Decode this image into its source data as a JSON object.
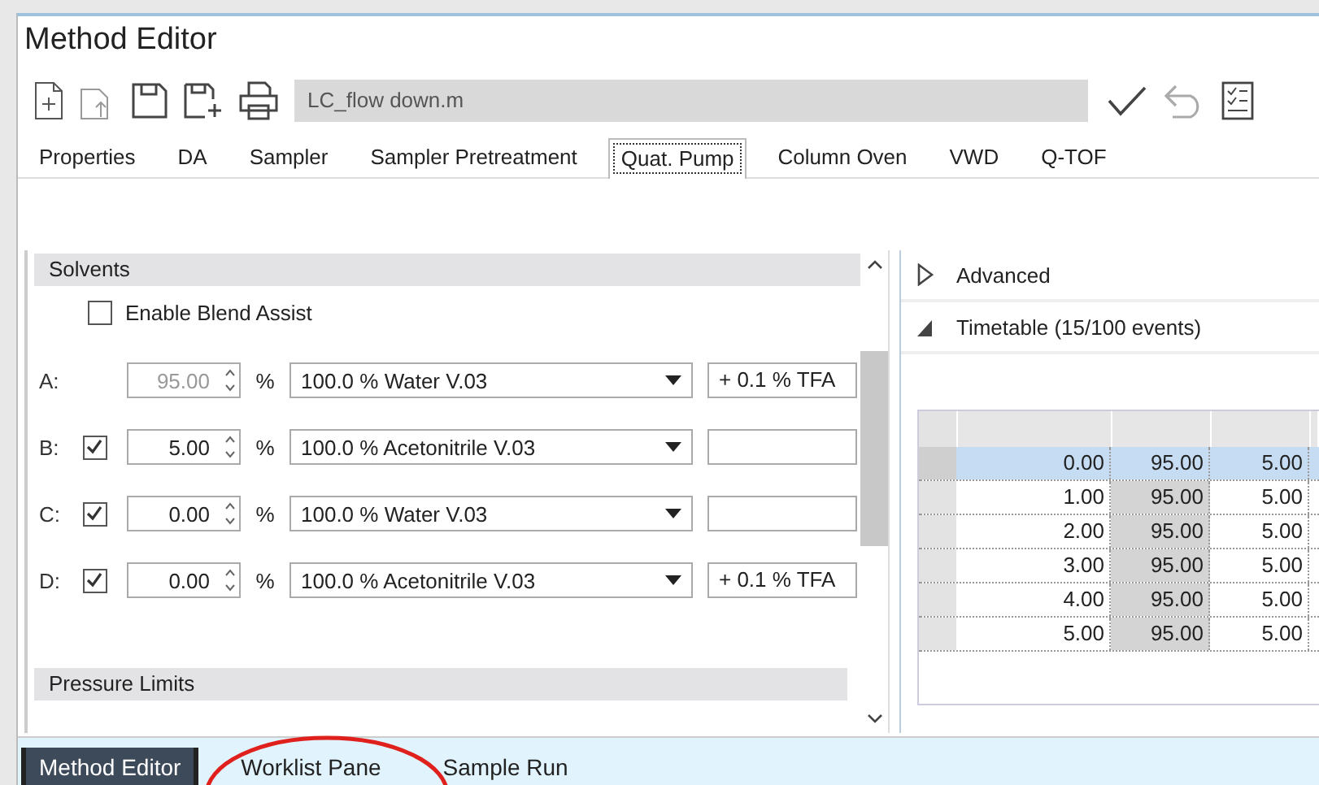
{
  "window": {
    "title": "Method Editor"
  },
  "toolbar": {
    "method_file": "LC_flow down.m"
  },
  "tabs": [
    {
      "label": "Properties",
      "selected": false
    },
    {
      "label": "DA",
      "selected": false
    },
    {
      "label": "Sampler",
      "selected": false
    },
    {
      "label": "Sampler Pretreatment",
      "selected": false
    },
    {
      "label": "Quat. Pump",
      "selected": true
    },
    {
      "label": "Column Oven",
      "selected": false
    },
    {
      "label": "VWD",
      "selected": false
    },
    {
      "label": "Q-TOF",
      "selected": false
    }
  ],
  "solvents": {
    "title": "Solvents",
    "blend_assist": {
      "label": "Enable Blend Assist",
      "checked": false
    },
    "unit": "%",
    "channels": [
      {
        "label": "A:",
        "value": "95.00",
        "disabled": true,
        "solvent": "100.0 % Water V.03",
        "additive": "+ 0.1 % TFA"
      },
      {
        "label": "B:",
        "checked": true,
        "value": "5.00",
        "disabled": false,
        "solvent": "100.0 % Acetonitrile V.03"
      },
      {
        "label": "C:",
        "checked": true,
        "value": "0.00",
        "disabled": false,
        "solvent": "100.0 % Water V.03"
      },
      {
        "label": "D:",
        "checked": true,
        "value": "0.00",
        "disabled": false,
        "solvent": "100.0 % Acetonitrile V.03",
        "additive": "+ 0.1 % TFA"
      }
    ]
  },
  "pressure_limits": {
    "title": "Pressure Limits"
  },
  "advanced": {
    "title": "Advanced",
    "expanded": false
  },
  "timetable": {
    "title": "Timetable (15/100 events)",
    "expanded": true,
    "rows": [
      {
        "time": "0.00",
        "a": "95.00",
        "b": "5.00",
        "selected": true
      },
      {
        "time": "1.00",
        "a": "95.00",
        "b": "5.00",
        "selected": false
      },
      {
        "time": "2.00",
        "a": "95.00",
        "b": "5.00",
        "selected": false
      },
      {
        "time": "3.00",
        "a": "95.00",
        "b": "5.00",
        "selected": false
      },
      {
        "time": "4.00",
        "a": "95.00",
        "b": "5.00",
        "selected": false
      },
      {
        "time": "5.00",
        "a": "95.00",
        "b": "5.00",
        "selected": false
      }
    ]
  },
  "bottom_tabs": [
    {
      "label": "Method Editor",
      "selected": true
    },
    {
      "label": "Worklist Pane",
      "selected": false
    },
    {
      "label": "Sample Run",
      "selected": false
    }
  ]
}
